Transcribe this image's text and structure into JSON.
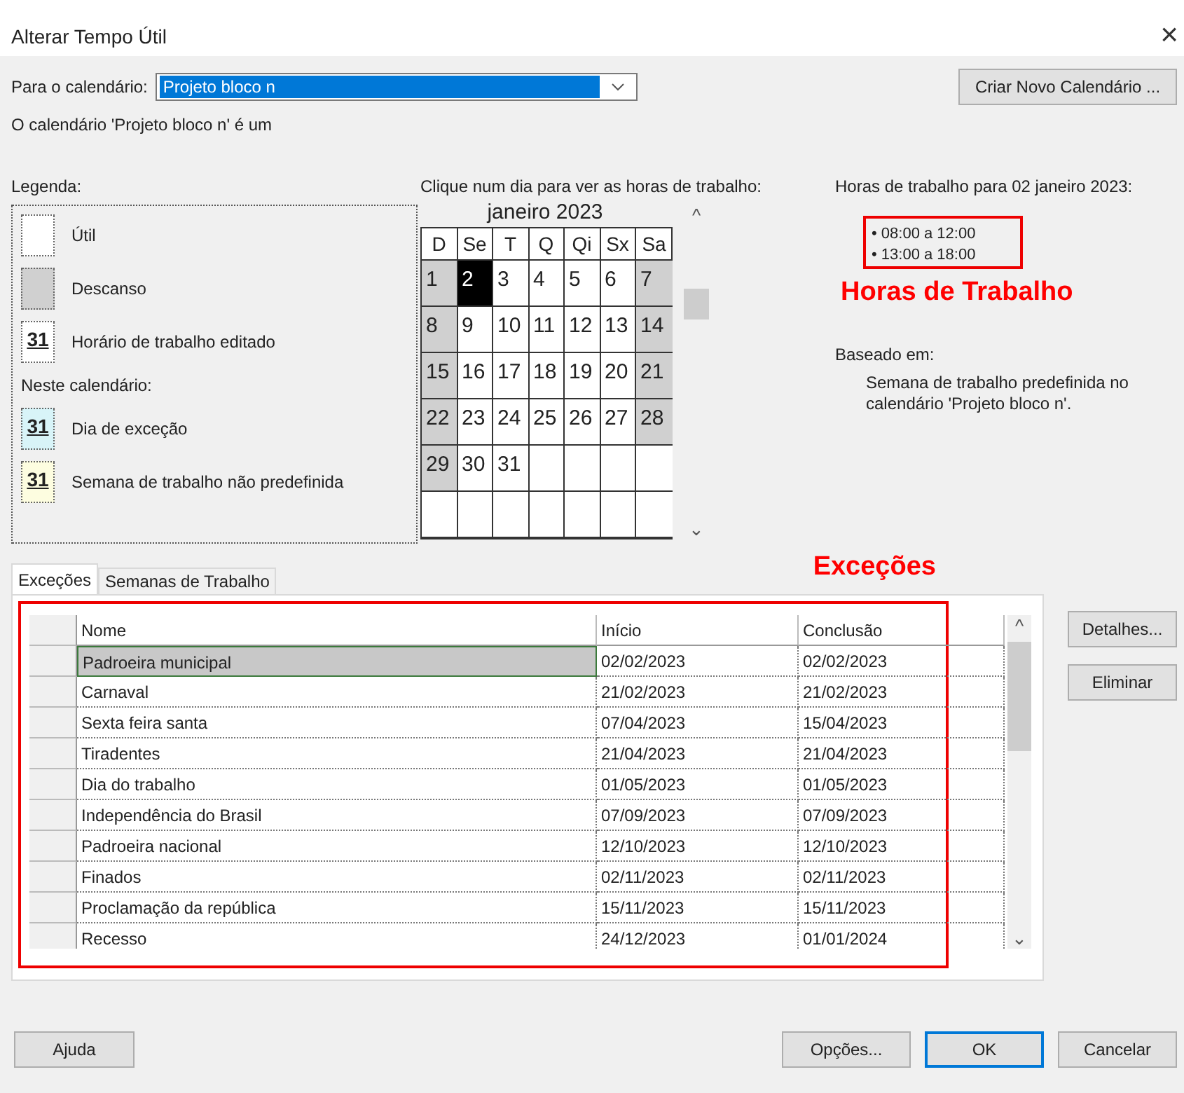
{
  "window": {
    "title": "Alterar Tempo Útil",
    "close": "×"
  },
  "calendar_field": {
    "label": "Para o calendário:",
    "value": "Projeto bloco n"
  },
  "new_calendar_button": "Criar Novo Calendário ...",
  "calendar_note": "O calendário 'Projeto bloco n' é um",
  "legend": {
    "title": "Legenda:",
    "items": [
      {
        "kind": "plain",
        "label": "Útil"
      },
      {
        "kind": "grey",
        "label": "Descanso"
      },
      {
        "kind": "edited",
        "mark": "31",
        "label": "Horário de trabalho editado"
      },
      {
        "kind": "heading",
        "label": "Neste calendário:"
      },
      {
        "kind": "exception",
        "mark": "31",
        "label": "Dia de exceção"
      },
      {
        "kind": "nondefault",
        "mark": "31",
        "label": "Semana de trabalho não predefinida"
      }
    ]
  },
  "calendar": {
    "prompt": "Clique num dia para ver as horas de trabalho:",
    "month": "janeiro 2023",
    "scroll_up": "^",
    "scroll_down": "⌄",
    "weekdays": [
      "D",
      "Se",
      "T",
      "Q",
      "Qi",
      "Sx",
      "Sa"
    ],
    "weeks": [
      [
        {
          "day": "1",
          "kind": "rest"
        },
        {
          "day": "2",
          "kind": "selected"
        },
        {
          "day": "3",
          "kind": "work"
        },
        {
          "day": "4",
          "kind": "work"
        },
        {
          "day": "5",
          "kind": "work"
        },
        {
          "day": "6",
          "kind": "work"
        },
        {
          "day": "7",
          "kind": "rest"
        }
      ],
      [
        {
          "day": "8",
          "kind": "rest"
        },
        {
          "day": "9",
          "kind": "work"
        },
        {
          "day": "10",
          "kind": "work"
        },
        {
          "day": "11",
          "kind": "work"
        },
        {
          "day": "12",
          "kind": "work"
        },
        {
          "day": "13",
          "kind": "work"
        },
        {
          "day": "14",
          "kind": "rest"
        }
      ],
      [
        {
          "day": "15",
          "kind": "rest"
        },
        {
          "day": "16",
          "kind": "work"
        },
        {
          "day": "17",
          "kind": "work"
        },
        {
          "day": "18",
          "kind": "work"
        },
        {
          "day": "19",
          "kind": "work"
        },
        {
          "day": "20",
          "kind": "work"
        },
        {
          "day": "21",
          "kind": "rest"
        }
      ],
      [
        {
          "day": "22",
          "kind": "rest"
        },
        {
          "day": "23",
          "kind": "work"
        },
        {
          "day": "24",
          "kind": "work"
        },
        {
          "day": "25",
          "kind": "work"
        },
        {
          "day": "26",
          "kind": "work"
        },
        {
          "day": "27",
          "kind": "work"
        },
        {
          "day": "28",
          "kind": "rest"
        }
      ],
      [
        {
          "day": "29",
          "kind": "rest"
        },
        {
          "day": "30",
          "kind": "work"
        },
        {
          "day": "31",
          "kind": "work"
        },
        {
          "kind": "empty"
        },
        {
          "kind": "empty"
        },
        {
          "kind": "empty"
        },
        {
          "kind": "empty"
        }
      ],
      [
        {
          "kind": "empty"
        },
        {
          "kind": "empty"
        },
        {
          "kind": "empty"
        },
        {
          "kind": "empty"
        },
        {
          "kind": "empty"
        },
        {
          "kind": "empty"
        },
        {
          "kind": "empty"
        }
      ]
    ]
  },
  "hours": {
    "title": "Horas de trabalho para 02 janeiro 2023:",
    "items": [
      "• 08:00 a 12:00",
      "• 13:00 a 18:00"
    ],
    "annotation": "Horas de Trabalho",
    "based_on_label": "Baseado em:",
    "based_on_text": "Semana de trabalho predefinida no calendário 'Projeto bloco n'."
  },
  "tabs": [
    {
      "label": "Exceções",
      "selected": true
    },
    {
      "label": "Semanas de Trabalho",
      "selected": false
    }
  ],
  "table_annotation": "Exceções",
  "table": {
    "columns": [
      "Nome",
      "Início",
      "Conclusão"
    ],
    "scroll_up": "^",
    "scroll_down": "⌄",
    "rows": [
      {
        "cells": [
          "Padroeira municipal",
          "02/02/2023",
          "02/02/2023"
        ],
        "selected": true
      },
      {
        "cells": [
          "Carnaval",
          "21/02/2023",
          "21/02/2023"
        ],
        "selected": false
      },
      {
        "cells": [
          "Sexta feira santa",
          "07/04/2023",
          "15/04/2023"
        ],
        "selected": false
      },
      {
        "cells": [
          "Tiradentes",
          "21/04/2023",
          "21/04/2023"
        ],
        "selected": false
      },
      {
        "cells": [
          "Dia do trabalho",
          "01/05/2023",
          "01/05/2023"
        ],
        "selected": false
      },
      {
        "cells": [
          "Independência do Brasil",
          "07/09/2023",
          "07/09/2023"
        ],
        "selected": false
      },
      {
        "cells": [
          "Padroeira nacional",
          "12/10/2023",
          "12/10/2023"
        ],
        "selected": false
      },
      {
        "cells": [
          "Finados",
          "02/11/2023",
          "02/11/2023"
        ],
        "selected": false
      },
      {
        "cells": [
          "Proclamação da república",
          "15/11/2023",
          "15/11/2023"
        ],
        "selected": false
      },
      {
        "cells": [
          "Recesso",
          "24/12/2023",
          "01/01/2024"
        ],
        "selected": false
      }
    ]
  },
  "side_buttons": [
    "Detalhes...",
    "Eliminar"
  ],
  "footer_buttons": [
    {
      "label": "Ajuda",
      "kind": "normal"
    },
    {
      "label": "Opções...",
      "kind": "normal"
    },
    {
      "label": "OK",
      "kind": "default"
    },
    {
      "label": "Cancelar",
      "kind": "normal"
    }
  ]
}
